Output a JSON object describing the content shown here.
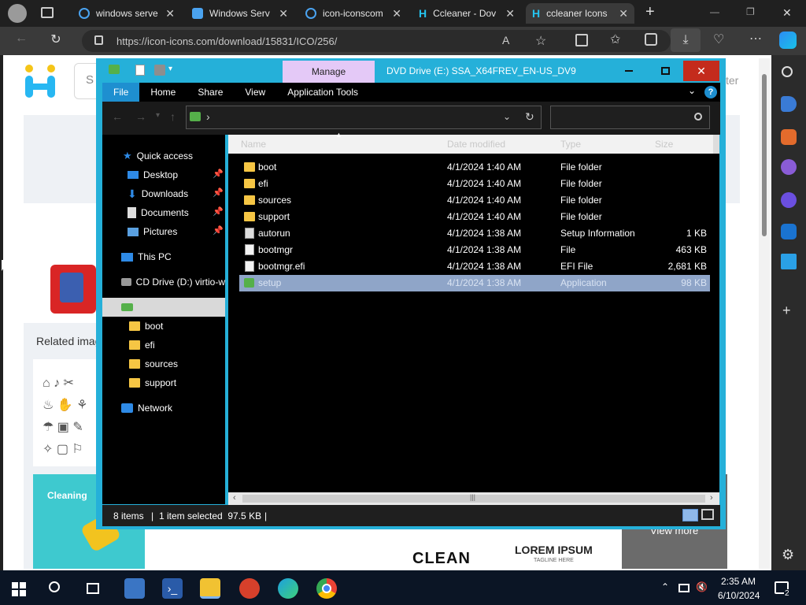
{
  "browser": {
    "tabs": [
      {
        "label": "windows serve",
        "favicon": "search-icon"
      },
      {
        "label": "Windows Serv",
        "favicon": "windows-icon"
      },
      {
        "label": "icon-iconscom",
        "favicon": "search-icon"
      },
      {
        "label": "Ccleaner - Dov",
        "favicon": "iconicons-h-icon"
      },
      {
        "label": "ccleaner Icons",
        "favicon": "iconicons-h-icon",
        "active": true
      }
    ],
    "new_tab": "+",
    "url": "https://icon-icons.com/download/15831/ICO/256/",
    "window_controls": [
      "—",
      "❐",
      "✕"
    ]
  },
  "website": {
    "search_placeholder_fragment": "S",
    "right_fragment": "ter",
    "related_heading": "Related image",
    "thumbnail_texts": [
      "Cleaning",
      "CLEAN",
      "LOREM IPSUM",
      "TAGLINE HERE",
      "View more"
    ]
  },
  "explorer": {
    "manage_label": "Manage",
    "title": "DVD Drive (E:) SSA_X64FREV_EN-US_DV9",
    "ribbon_tabs": [
      "File",
      "Home",
      "Share",
      "View",
      "Application Tools"
    ],
    "path_separator": "›",
    "columns": [
      "Name",
      "Date modified",
      "Type",
      "Size"
    ],
    "nav": [
      {
        "label": "Quick access",
        "icon": "star-icon",
        "indent": 0
      },
      {
        "label": "Desktop",
        "icon": "desktop-icon",
        "indent": 1,
        "pinned": true
      },
      {
        "label": "Downloads",
        "icon": "download-arrow-icon",
        "indent": 1,
        "pinned": true
      },
      {
        "label": "Documents",
        "icon": "document-icon",
        "indent": 1,
        "pinned": true
      },
      {
        "label": "Pictures",
        "icon": "pictures-icon",
        "indent": 1,
        "pinned": true
      },
      {
        "label": "This PC",
        "icon": "computer-icon",
        "indent": 0
      },
      {
        "label": "CD Drive (D:) virtio-w",
        "icon": "cd-drive-icon",
        "indent": 0
      },
      {
        "label": "",
        "icon": "dvd-drive-icon",
        "indent": 0,
        "selected": true
      },
      {
        "label": "boot",
        "icon": "folder-icon",
        "indent": 1
      },
      {
        "label": "efi",
        "icon": "folder-icon",
        "indent": 1
      },
      {
        "label": "sources",
        "icon": "folder-icon",
        "indent": 1
      },
      {
        "label": "support",
        "icon": "folder-icon",
        "indent": 1
      },
      {
        "label": "Network",
        "icon": "network-icon",
        "indent": 0
      }
    ],
    "files": [
      {
        "name": "boot",
        "date": "4/1/2024 1:40 AM",
        "type": "File folder",
        "size": "",
        "icon": "folder-icon"
      },
      {
        "name": "efi",
        "date": "4/1/2024 1:40 AM",
        "type": "File folder",
        "size": "",
        "icon": "folder-icon"
      },
      {
        "name": "sources",
        "date": "4/1/2024 1:40 AM",
        "type": "File folder",
        "size": "",
        "icon": "folder-icon"
      },
      {
        "name": "support",
        "date": "4/1/2024 1:40 AM",
        "type": "File folder",
        "size": "",
        "icon": "folder-icon"
      },
      {
        "name": "autorun",
        "date": "4/1/2024 1:38 AM",
        "type": "Setup Information",
        "size": "1 KB",
        "icon": "setup-info-icon"
      },
      {
        "name": "bootmgr",
        "date": "4/1/2024 1:38 AM",
        "type": "File",
        "size": "463 KB",
        "icon": "file-icon"
      },
      {
        "name": "bootmgr.efi",
        "date": "4/1/2024 1:38 AM",
        "type": "EFI File",
        "size": "2,681 KB",
        "icon": "file-icon"
      },
      {
        "name": "setup",
        "date": "4/1/2024 1:38 AM",
        "type": "Application",
        "size": "98 KB",
        "icon": "setup-app-icon",
        "selected": true
      }
    ],
    "status_items": "8 items",
    "status_selected": "1 item selected  97.5 KB",
    "status_sep": "|"
  },
  "taskbar": {
    "time": "2:35 AM",
    "date": "6/10/2024",
    "notification_count": "2",
    "apps": [
      "start-icon",
      "search-icon",
      "task-view-icon",
      "server-manager-icon",
      "powershell-icon",
      "file-explorer-icon",
      "ccleaner-icon",
      "edge-icon",
      "chrome-icon"
    ]
  }
}
